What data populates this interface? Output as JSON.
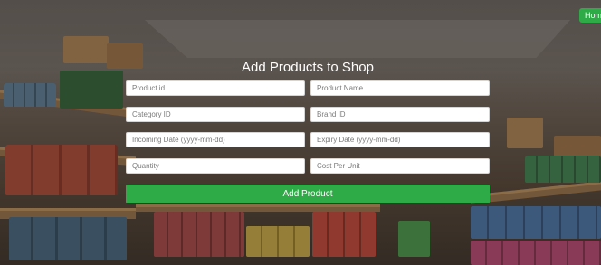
{
  "header": {
    "home_label": "Home"
  },
  "form": {
    "title": "Add Products to Shop",
    "fields": {
      "product_id": {
        "placeholder": "Product id",
        "value": ""
      },
      "product_name": {
        "placeholder": "Product Name",
        "value": ""
      },
      "category_id": {
        "placeholder": "Category ID",
        "value": ""
      },
      "brand_id": {
        "placeholder": "Brand ID",
        "value": ""
      },
      "incoming_date": {
        "placeholder": "Incoming Date (yyyy-mm-dd)",
        "value": ""
      },
      "expiry_date": {
        "placeholder": "Expiry Date (yyyy-mm-dd)",
        "value": ""
      },
      "quantity": {
        "placeholder": "Quantity",
        "value": ""
      },
      "cost_per_unit": {
        "placeholder": "Cost Per Unit",
        "value": ""
      }
    },
    "submit_label": "Add Product"
  },
  "colors": {
    "accent_green": "#2eab46",
    "title_text": "#ffffff"
  }
}
